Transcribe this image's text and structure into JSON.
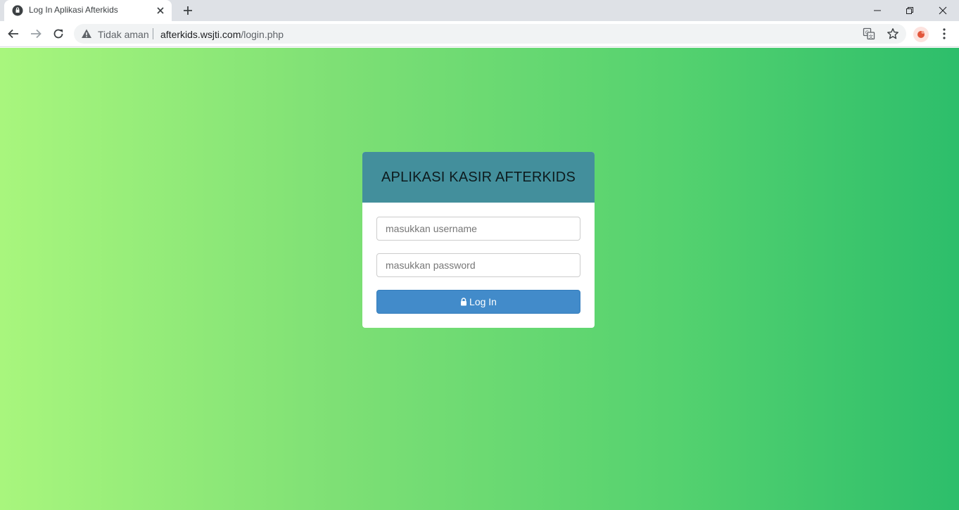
{
  "browser": {
    "tab_title": "Log In Aplikasi Afterkids",
    "security_label": "Tidak aman",
    "url_host": "afterkids.wsjti.com",
    "url_path": "/login.php"
  },
  "login": {
    "title": "APLIKASI KASIR AFTERKIDS",
    "username_placeholder": "masukkan username",
    "password_placeholder": "masukkan password",
    "button_label": "Log In"
  },
  "colors": {
    "header_bg": "#438f9c",
    "button_bg": "#428bca",
    "gradient_start": "#a8f67d",
    "gradient_end": "#2dbe6b"
  },
  "icons": {
    "tab_favicon": "globe-icon",
    "new_tab": "plus-icon",
    "security": "warning-icon",
    "button": "lock-icon"
  }
}
